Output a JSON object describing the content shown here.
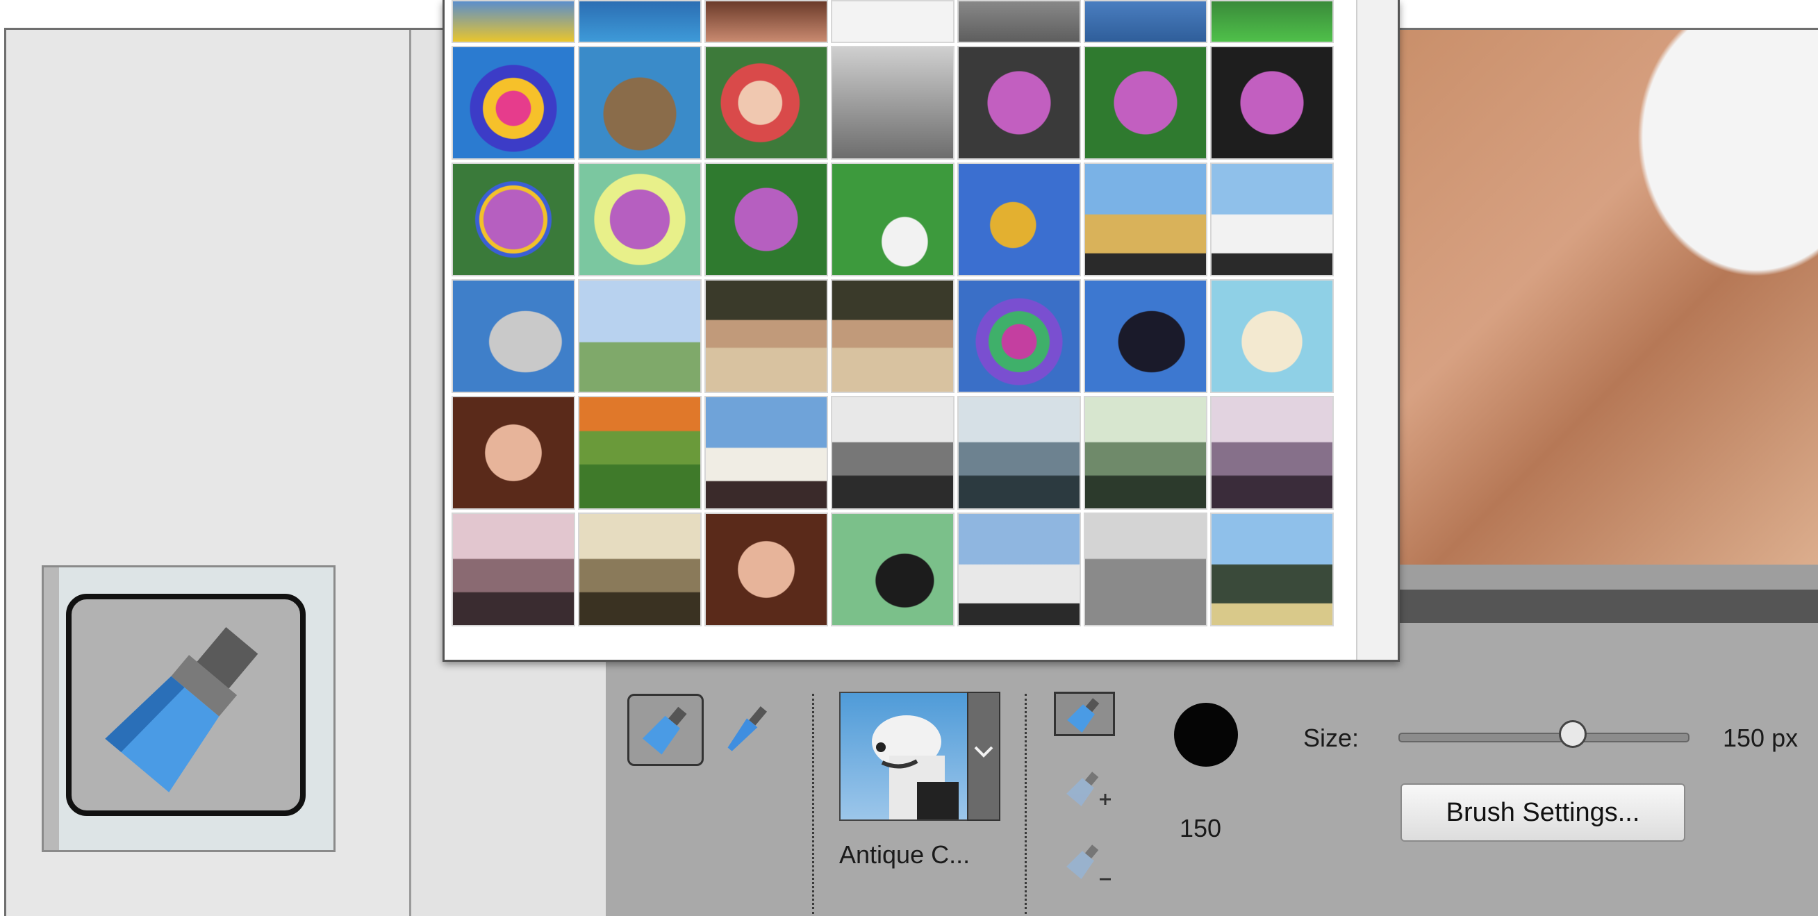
{
  "options_bar": {
    "preset_label": "Antique C...",
    "size_label": "Size:",
    "size_value": "150 px",
    "brush_value": "150",
    "brush_settings_label": "Brush Settings...",
    "size_slider_level": 0.6
  },
  "icons": {
    "tool": "brush-icon",
    "mode": "brush-icon",
    "impressionist": "brush-icon",
    "new_selection": "brush-icon",
    "add": "brush-plus-icon",
    "subtract": "brush-minus-icon",
    "dropdown": "chevron-down-icon"
  },
  "picker": {
    "rows": [
      [
        "photo",
        "photo",
        "photo",
        "sketch",
        "photo",
        "photo",
        "photo"
      ],
      [
        "neon-dog",
        "cat",
        "baby",
        "bw-tree",
        "rose",
        "rose",
        "rose"
      ],
      [
        "rainbow-rose",
        "glow-rose",
        "rose",
        "swan",
        "leaf",
        "lighthouse",
        "lighthouse"
      ],
      [
        "mono-dog",
        "pale-field",
        "family",
        "family",
        "neon-dog",
        "dark-dog",
        "couple"
      ],
      [
        "girl",
        "tree-field",
        "lighthouse",
        "bridge",
        "bridge",
        "bridge",
        "bridge"
      ],
      [
        "bridge",
        "bridge",
        "girl",
        "silhouette",
        "lighthouse",
        "bw-tree",
        "lighthouse"
      ]
    ]
  },
  "colors": {
    "panel_bg": "#e6e6e6",
    "options_bg": "#a9a9a9",
    "accent_blue": "#4f9fe6",
    "brush_gray": "#6b6b6b"
  }
}
